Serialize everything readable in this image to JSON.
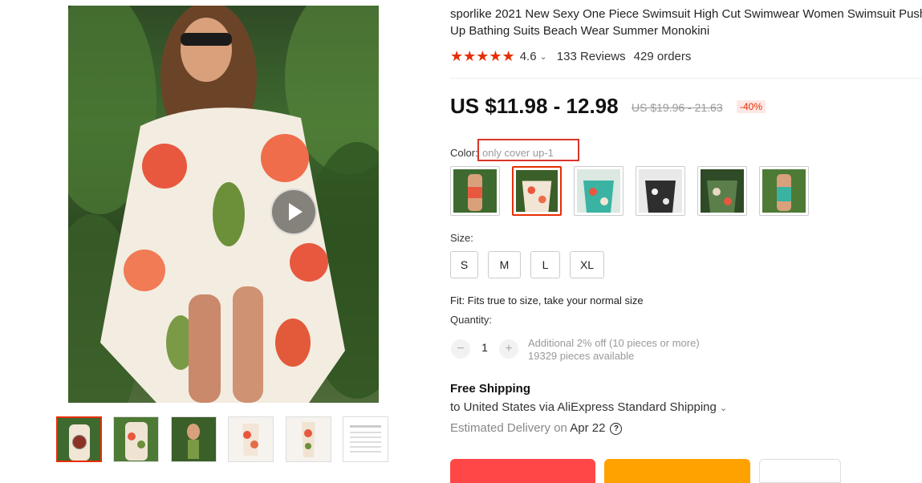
{
  "product": {
    "title": "sporlike 2021 New Sexy One Piece Swimsuit High Cut Swimwear Women Swimsuit Push Up Bathing Suits Beach Wear Summer Monokini",
    "rating": "4.6",
    "reviews": "133 Reviews",
    "orders": "429 orders",
    "price": "US $11.98 - 12.98",
    "original_price": "US $19.96 - 21.63",
    "discount": "-40%"
  },
  "color": {
    "label": "Color:",
    "selected": "only cover up-1",
    "swatch_count": 6,
    "selected_index": 1
  },
  "size": {
    "label": "Size:",
    "options": [
      "S",
      "M",
      "L",
      "XL"
    ]
  },
  "fit": "Fit: Fits true to size, take your normal size",
  "quantity": {
    "label": "Quantity:",
    "value": "1",
    "minus": "−",
    "plus": "+",
    "discount_note": "Additional 2% off (10 pieces or more)",
    "available": "19329 pieces available"
  },
  "shipping": {
    "title": "Free Shipping",
    "destination": "to United States via AliExpress Standard Shipping",
    "delivery_prefix": "Estimated Delivery on",
    "delivery_date": "Apr 22"
  },
  "icons": {
    "play": "play-icon",
    "star": "star-icon",
    "chevron": "chevron-down-icon",
    "help": "question-circle-icon"
  },
  "colors": {
    "accent": "#e62e04",
    "highlight_box": "#d9352b",
    "buy_button": "#ff4747",
    "cart_button": "#ffa200"
  }
}
